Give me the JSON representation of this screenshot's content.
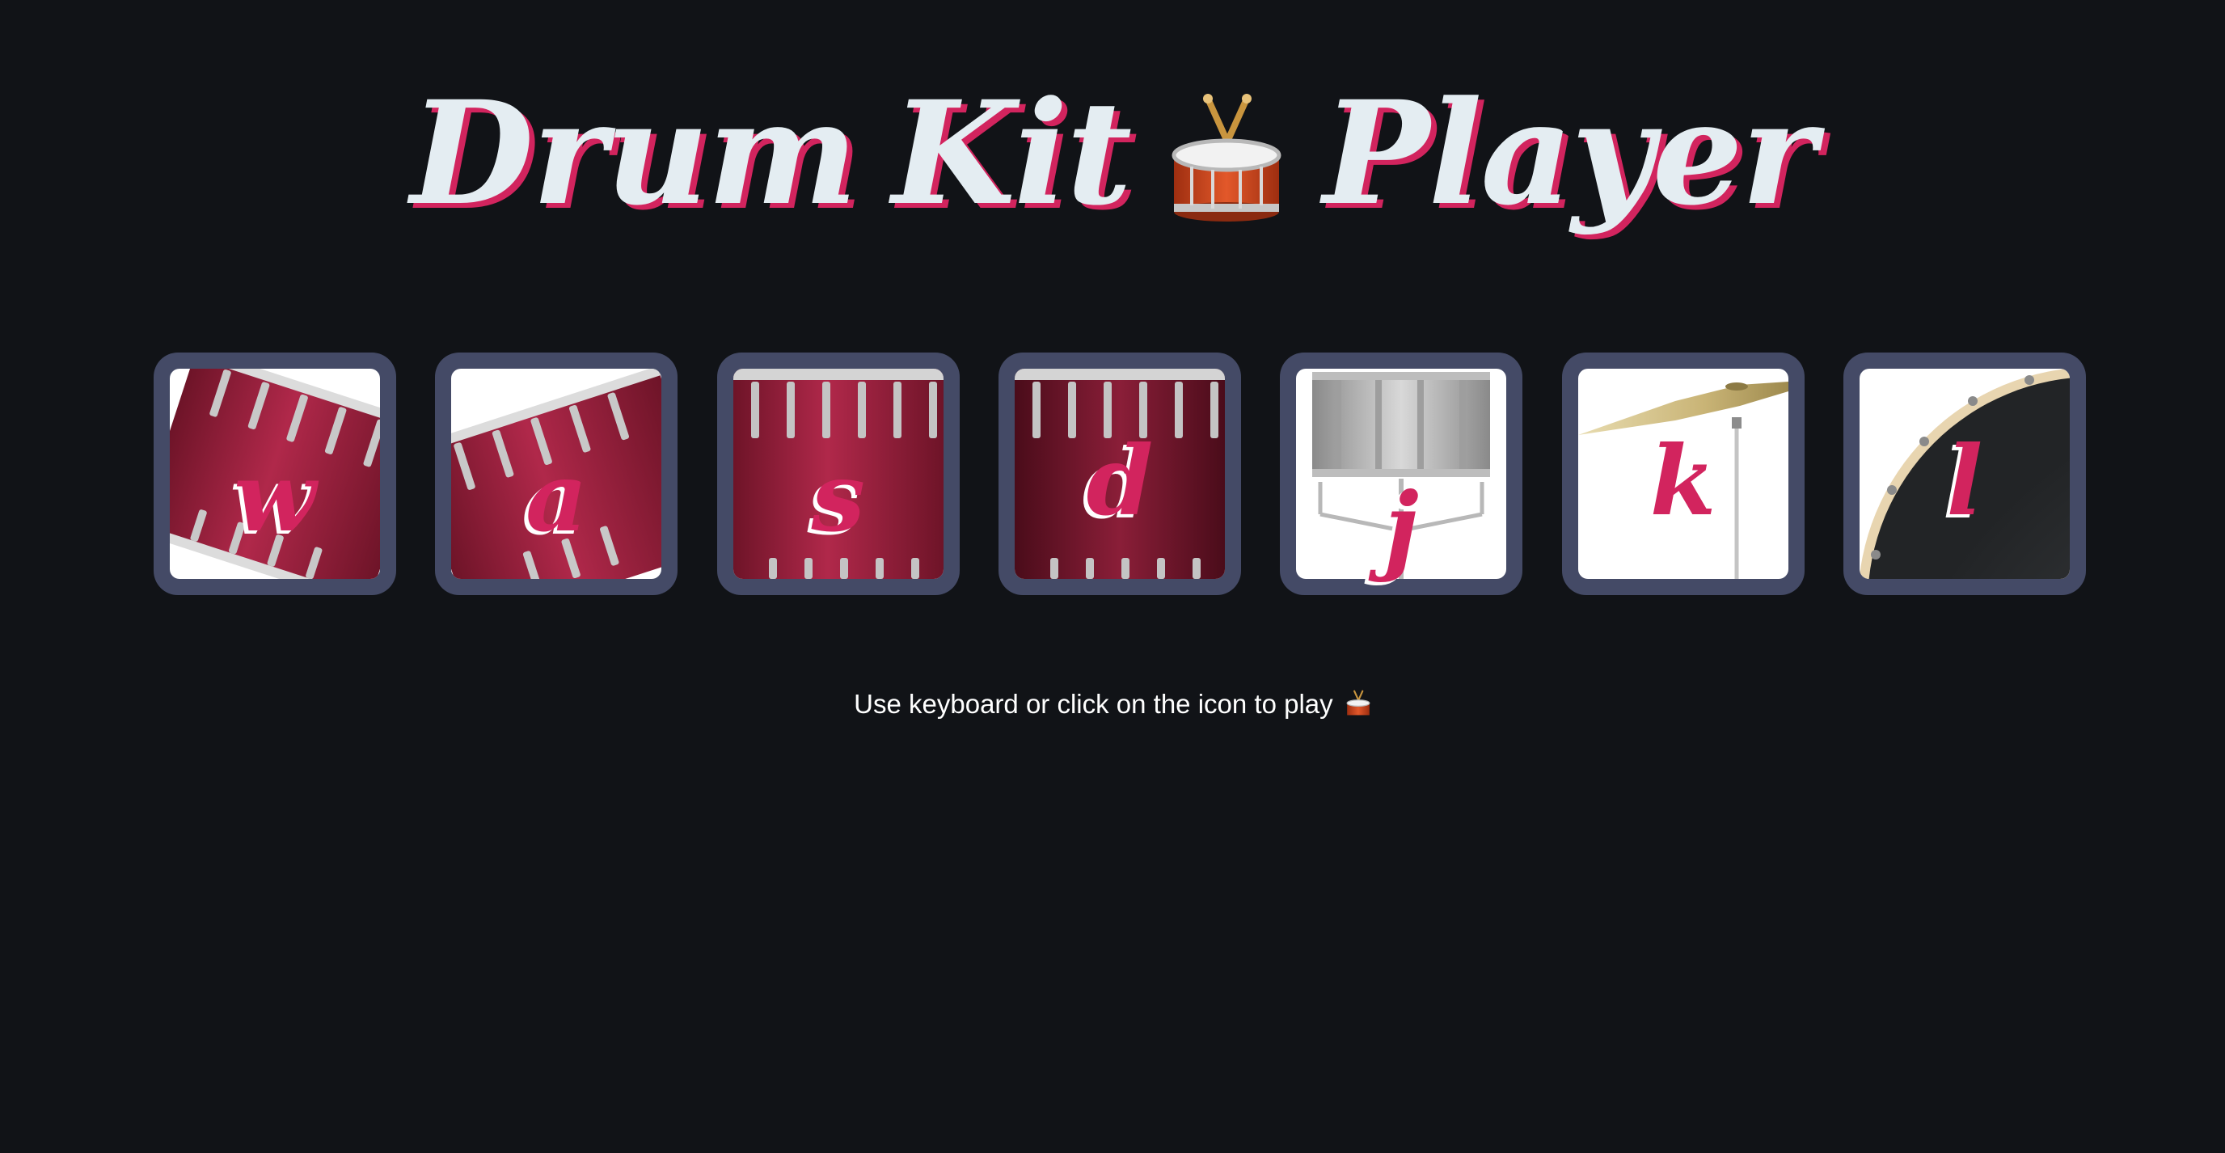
{
  "header": {
    "title_part1": "Drum",
    "title_part2": "Kit",
    "title_part3": "Player",
    "title_icon": "drum-icon"
  },
  "pads": [
    {
      "key": "w",
      "art": "tom-tilted-left-art"
    },
    {
      "key": "a",
      "art": "tom-tilted-right-art"
    },
    {
      "key": "s",
      "art": "snare-drum-art"
    },
    {
      "key": "d",
      "art": "floor-tom-art"
    },
    {
      "key": "j",
      "art": "silver-snare-stand-art"
    },
    {
      "key": "k",
      "art": "cymbal-stand-art"
    },
    {
      "key": "l",
      "art": "bass-drum-art"
    }
  ],
  "footer": {
    "hint": "Use keyboard or click on the icon to play",
    "hint_icon": "drum-icon"
  },
  "colors": {
    "background": "#111317",
    "pad_frame": "#444a66",
    "accent": "#d2245e",
    "title_text": "#e4edf2"
  }
}
